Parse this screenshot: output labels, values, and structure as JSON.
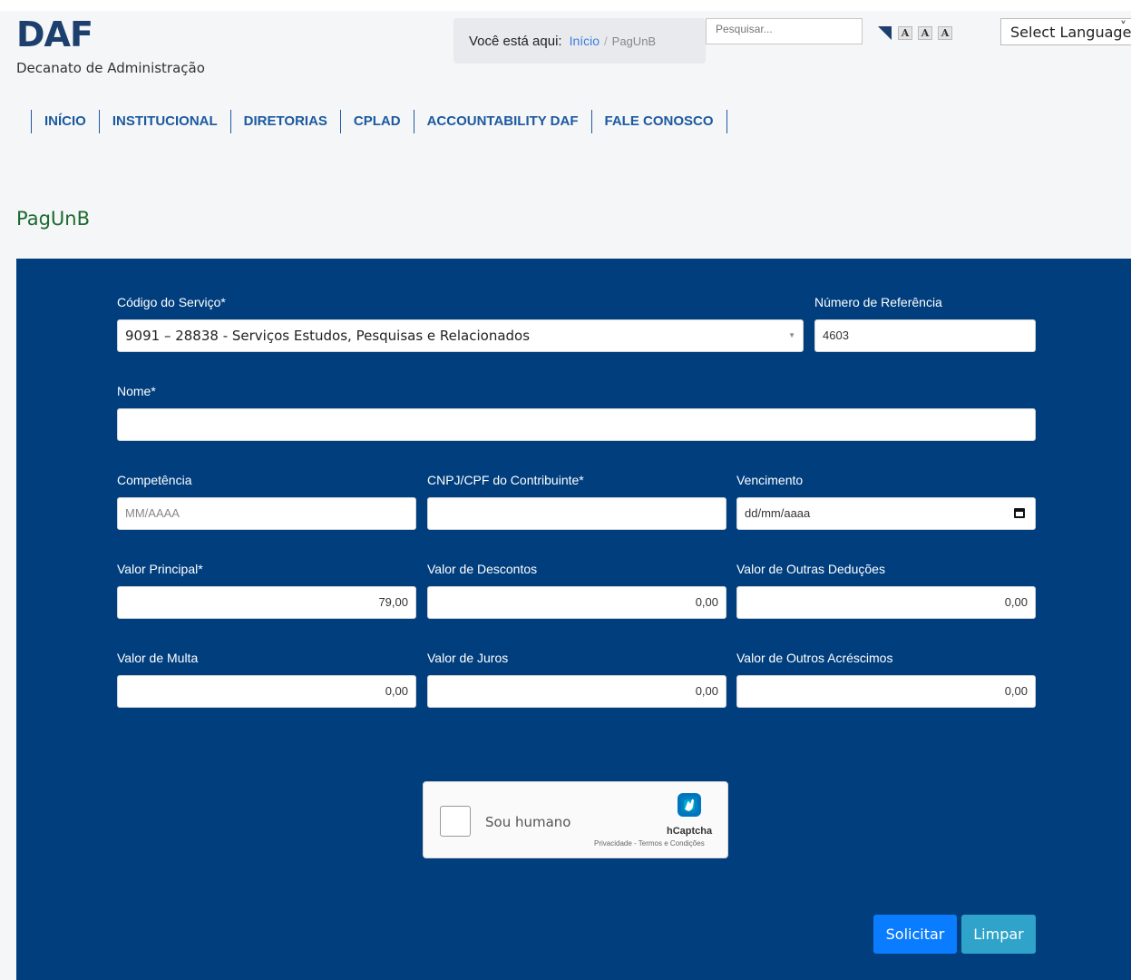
{
  "header": {
    "brand": "DAF",
    "subtitle": "Decanato de Administração"
  },
  "breadcrumb": {
    "label": "Você está aqui:",
    "home": "Início",
    "separator": "/",
    "current": "PagUnB"
  },
  "search": {
    "placeholder": "Pesquisar..."
  },
  "accessibility": {
    "font_sizes": [
      "A",
      "A",
      "A"
    ]
  },
  "language": {
    "label": "Select Language"
  },
  "nav": [
    "INÍCIO",
    "INSTITUCIONAL",
    "DIRETORIAS",
    "CPLAD",
    "ACCOUNTABILITY DAF",
    "FALE CONOSCO"
  ],
  "page": {
    "title": "PagUnB"
  },
  "form": {
    "servico": {
      "label": "Código do Serviço*",
      "value": "9091 – 28838 - Serviços Estudos, Pesquisas e Relacionados"
    },
    "referencia": {
      "label": "Número de Referência",
      "value": "4603"
    },
    "nome": {
      "label": "Nome*",
      "value": ""
    },
    "competencia": {
      "label": "Competência",
      "placeholder": "MM/AAAA"
    },
    "cnpj": {
      "label": "CNPJ/CPF do Contribuinte*",
      "value": ""
    },
    "vencimento": {
      "label": "Vencimento",
      "placeholder": "dd/mm/aaaa"
    },
    "valor_principal": {
      "label": "Valor Principal*",
      "value": "79,00"
    },
    "valor_descontos": {
      "label": "Valor de Descontos",
      "value": "0,00"
    },
    "valor_deducoes": {
      "label": "Valor de Outras Deduções",
      "value": "0,00"
    },
    "valor_multa": {
      "label": "Valor de Multa",
      "value": "0,00"
    },
    "valor_juros": {
      "label": "Valor de Juros",
      "value": "0,00"
    },
    "valor_acrescimos": {
      "label": "Valor de Outros Acréscimos",
      "value": "0,00"
    }
  },
  "captcha": {
    "label": "Sou humano",
    "brand": "hCaptcha",
    "links": "Privacidade - Termos e Condições"
  },
  "buttons": {
    "submit": "Solicitar",
    "clear": "Limpar"
  },
  "colors": {
    "panel": "#003e7e",
    "primary": "#0a7cff",
    "secondary": "#2fa3c9",
    "nav": "#1c5aa0",
    "title_green": "#1a6b2e"
  }
}
